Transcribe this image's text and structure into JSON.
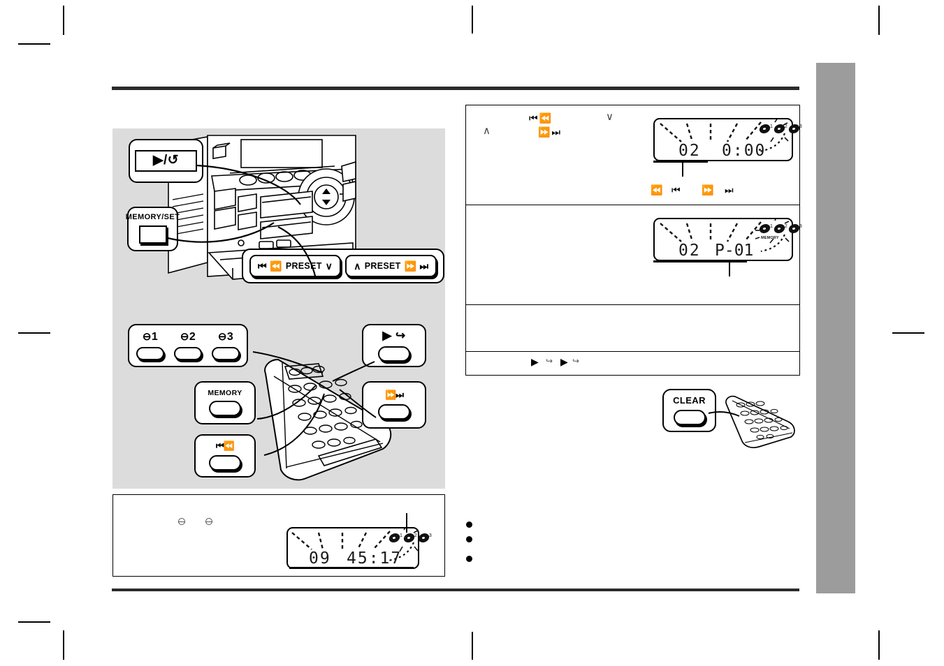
{
  "page": {
    "document_type": "audio-system-operation-manual-page",
    "background_color": "#ffffff",
    "thumb_tab_color": "#9c9c9c",
    "illustration_panel_color": "#dcdcdc"
  },
  "unit_callouts": [
    {
      "id": "play-repeat",
      "label": "▶/↺",
      "kind": "plate-button",
      "glyph_name": "play-repeat-icon"
    },
    {
      "id": "memory-set",
      "label": "MEMORY/SET",
      "kind": "square-button"
    }
  ],
  "preset_bar": {
    "left_key": {
      "label": "PRESET",
      "prefix_glyph": "⏮ ⏪",
      "suffix_glyph": "∨",
      "glyph_name": "preset-down-icon"
    },
    "right_key": {
      "label": "PRESET",
      "prefix_glyph": "∧",
      "suffix_glyph": "⏩ ⏭",
      "glyph_name": "preset-up-icon"
    }
  },
  "remote_callouts": [
    {
      "id": "disc-1",
      "label": "1",
      "glyph_name": "disc-1-icon"
    },
    {
      "id": "disc-2",
      "label": "2",
      "glyph_name": "disc-2-icon"
    },
    {
      "id": "disc-3",
      "label": "3",
      "glyph_name": "disc-3-icon"
    },
    {
      "id": "memory",
      "label": "MEMORY",
      "glyph_name": "memory-button-icon"
    },
    {
      "id": "skip-back",
      "label": "⏮⏪",
      "glyph_name": "skip-back-icon"
    },
    {
      "id": "play-repeat-remote",
      "label": "▶ ↪",
      "glyph_name": "play-repeat-icon"
    },
    {
      "id": "skip-forward",
      "label": "⏩⏭",
      "glyph_name": "skip-forward-icon"
    },
    {
      "id": "clear",
      "label": "CLEAR",
      "glyph_name": "clear-button-icon"
    }
  ],
  "procedure_table": {
    "rows": [
      {
        "id": "row-1",
        "inline_glyphs": [
          "⏮ ⏪",
          "⏩ ⏭",
          "∨",
          "∧"
        ],
        "footer_glyphs": [
          "⏪",
          "⏮",
          "⏩",
          "⏭"
        ],
        "display": {
          "name": "lcd-display-track-time",
          "track_number": "02",
          "time": "0:00",
          "disc_indicators": [
            "1",
            "2",
            "3"
          ],
          "memory_text": "",
          "active_disc": 2,
          "leader": "track-number"
        }
      },
      {
        "id": "row-2",
        "display": {
          "name": "lcd-display-program-position",
          "track_number": "02",
          "program": "P-01",
          "disc_indicators": [
            "1",
            "2",
            "3"
          ],
          "memory_text": "MEMORY",
          "active_disc": 2,
          "leader": "program-number"
        }
      },
      {
        "id": "row-3",
        "inline_glyphs": []
      },
      {
        "id": "row-4",
        "inline_glyphs": [
          "▶",
          "↪",
          "▶",
          "↪"
        ]
      }
    ]
  },
  "note_panel": {
    "name": "note-panel-total-time",
    "marks": [
      "eject-mark",
      "eject-mark"
    ],
    "display": {
      "name": "lcd-display-total-time",
      "track_number": "09",
      "time": "45:17",
      "disc_indicators": [
        "1",
        "2",
        "3"
      ],
      "active_disc": 2,
      "leader": "disc-indicator"
    }
  },
  "right_bullets": {
    "count": 3
  },
  "clear_callout": {
    "label": "CLEAR"
  }
}
